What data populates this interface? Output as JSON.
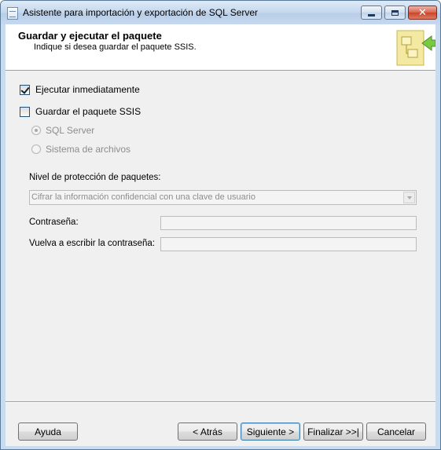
{
  "window": {
    "title": "Asistente para importación y exportación de SQL Server",
    "close_glyph": "✕"
  },
  "header": {
    "title": "Guardar y ejecutar el paquete",
    "subtitle": "Indique si desea guardar el paquete SSIS."
  },
  "options": {
    "run_immediately": {
      "label": "Ejecutar inmediatamente",
      "checked": true
    },
    "save_package": {
      "label": "Guardar el paquete SSIS",
      "checked": false
    },
    "location_sql_server": {
      "label": "SQL Server",
      "selected": true,
      "enabled": false
    },
    "location_file_system": {
      "label": "Sistema de archivos",
      "selected": false,
      "enabled": false
    }
  },
  "protection": {
    "label": "Nivel de protección de paquetes:",
    "selected_value": "Cifrar la información confidencial con una clave de usuario"
  },
  "password": {
    "label": "Contraseña:",
    "value": ""
  },
  "confirm_password": {
    "label": "Vuelva a escribir la contraseña:",
    "value": ""
  },
  "buttons": {
    "help": "Ayuda",
    "back": "< Atrás",
    "next": "Siguiente >",
    "finish": "Finalizar >>|",
    "cancel": "Cancelar"
  },
  "icons": {
    "app": "wizard-app-icon",
    "header": "package-arrow-icon"
  },
  "colors": {
    "titlebar": "#c4d7ed",
    "dialog_bg": "#f0f0f0",
    "disabled_text": "#8d8d8d",
    "header_art": "#f4e9a3"
  }
}
